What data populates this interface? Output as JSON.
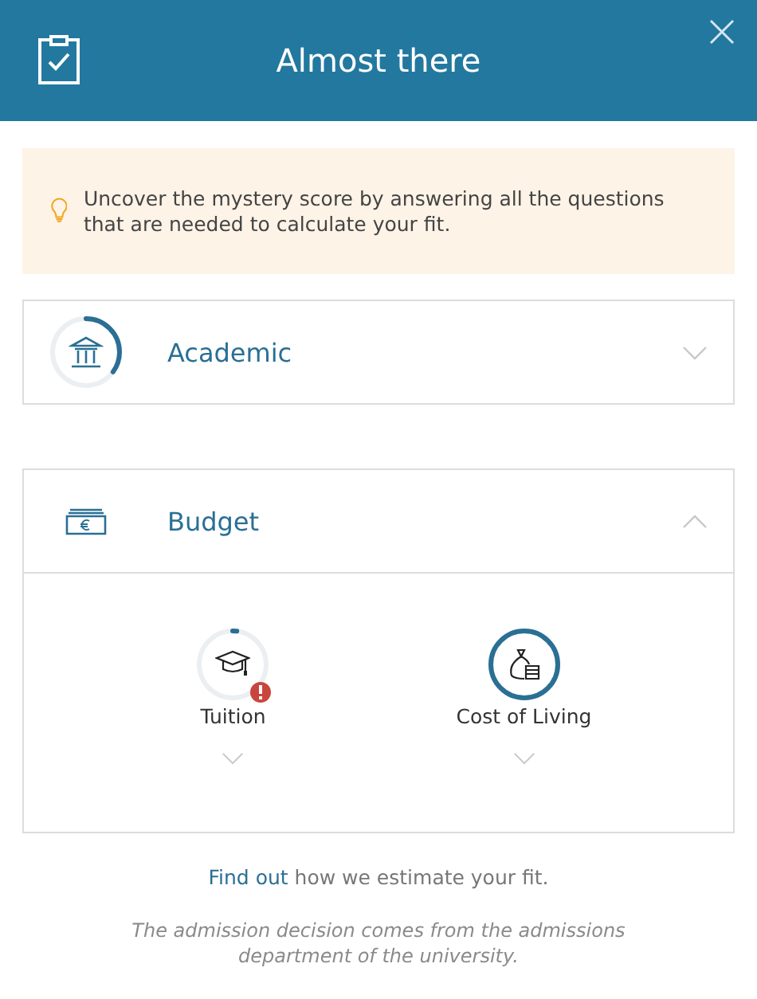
{
  "header": {
    "title": "Almost there"
  },
  "tip": {
    "text": "Uncover the mystery score by answering all the questions that are needed to calculate your fit."
  },
  "sections": [
    {
      "title": "Academic",
      "expanded": false,
      "level": 0.35
    },
    {
      "title": "Budget",
      "expanded": true,
      "items": [
        {
          "label": "Tuition",
          "level": 0.02,
          "warning": true,
          "expanded": false
        },
        {
          "label": "Cost of Living",
          "level": 1,
          "warning": false,
          "expanded": false
        }
      ]
    }
  ],
  "footer": {
    "link": "Find out",
    "rest": "how we estimate your fit.",
    "note": "The admission decision comes from the admissions department of the university."
  }
}
